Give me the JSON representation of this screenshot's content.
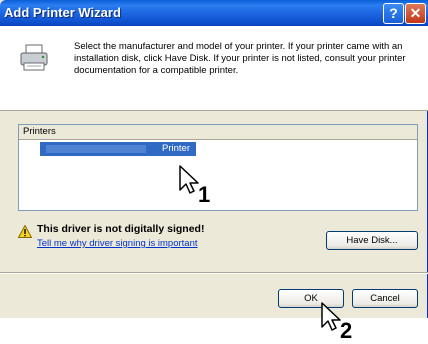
{
  "window": {
    "title": "Add Printer Wizard"
  },
  "title_buttons": {
    "help": "?",
    "close": "✕"
  },
  "header": {
    "icon": "printer-icon",
    "text": "Select the manufacturer and model of your printer. If your printer came with an installation disk, click Have Disk. If your printer is not listed, consult your printer documentation for a compatible printer."
  },
  "list": {
    "header": "Printers",
    "items": [
      {
        "label": "Printer",
        "selected": true
      }
    ]
  },
  "warning": {
    "icon": "warning-icon",
    "title": "This driver is not digitally signed!",
    "link": "Tell me why driver signing is important"
  },
  "buttons": {
    "have_disk": "Have Disk...",
    "ok": "OK",
    "cancel": "Cancel"
  },
  "annotations": {
    "step1": "1",
    "step2": "2"
  },
  "colors": {
    "titlebar": "#0a5fd8",
    "selection": "#316ac5",
    "dialog": "#ece9d8",
    "link": "#0033cc"
  }
}
